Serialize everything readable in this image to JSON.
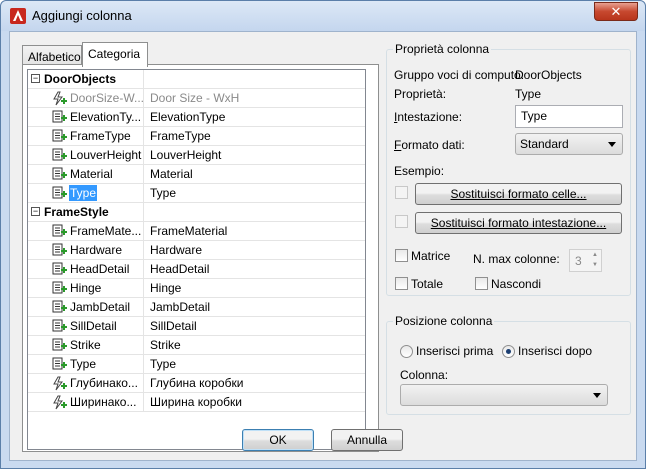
{
  "window": {
    "title": "Aggiungi colonna",
    "close_glyph": "✕"
  },
  "tabs": {
    "alfabetico": "Alfabetico",
    "categoria": "Categoria"
  },
  "tree": {
    "groups": [
      {
        "name": "DoorObjects",
        "rows": [
          {
            "label": "DoorSize-W...",
            "value": "Door Size - WxH",
            "icon": "formula-icon",
            "disabled": true
          },
          {
            "label": "ElevationTy...",
            "value": "ElevationType",
            "icon": "property-set-icon"
          },
          {
            "label": "FrameType",
            "value": "FrameType",
            "icon": "property-set-icon"
          },
          {
            "label": "LouverHeight",
            "value": "LouverHeight",
            "icon": "property-set-icon"
          },
          {
            "label": "Material",
            "value": "Material",
            "icon": "property-set-icon"
          },
          {
            "label": "Type",
            "value": "Type",
            "icon": "property-set-icon",
            "selected": true
          }
        ]
      },
      {
        "name": "FrameStyle",
        "rows": [
          {
            "label": "FrameMate...",
            "value": "FrameMaterial",
            "icon": "property-set-icon"
          },
          {
            "label": "Hardware",
            "value": "Hardware",
            "icon": "property-set-icon"
          },
          {
            "label": "HeadDetail",
            "value": "HeadDetail",
            "icon": "property-set-icon"
          },
          {
            "label": "Hinge",
            "value": "Hinge",
            "icon": "property-set-icon"
          },
          {
            "label": "JambDetail",
            "value": "JambDetail",
            "icon": "property-set-icon"
          },
          {
            "label": "SillDetail",
            "value": "SillDetail",
            "icon": "property-set-icon"
          },
          {
            "label": "Strike",
            "value": "Strike",
            "icon": "property-set-icon"
          },
          {
            "label": "Type",
            "value": "Type",
            "icon": "property-set-icon"
          },
          {
            "label": "Глубинако...",
            "value": "Глубина коробки",
            "icon": "formula-icon"
          },
          {
            "label": "Ширинако...",
            "value": "Ширина коробки",
            "icon": "formula-icon"
          }
        ]
      }
    ]
  },
  "properties": {
    "legend": "Proprietà colonna",
    "group_label": "Gruppo voci di computo:",
    "group_value": "DoorObjects",
    "property_label": "Proprietà:",
    "property_value": "Type",
    "heading_label": "Intestazione:",
    "heading_value": "Type",
    "format_label": "Formato dati:",
    "format_value": "Standard",
    "example_label": "Esempio:",
    "replace_cell_btn": "Sostituisci formato celle...",
    "replace_heading_btn": "Sostituisci formato intestazione...",
    "matrix_label": "Matrice",
    "max_columns_label": "N. max colonne:",
    "max_columns_value": "3",
    "total_label": "Totale",
    "hide_label": "Nascondi"
  },
  "position": {
    "legend": "Posizione colonna",
    "insert_before": "Inserisci prima",
    "insert_after": "Inserisci dopo",
    "column_label": "Colonna:",
    "column_value": ""
  },
  "footer": {
    "ok": "OK",
    "cancel": "Annulla"
  }
}
